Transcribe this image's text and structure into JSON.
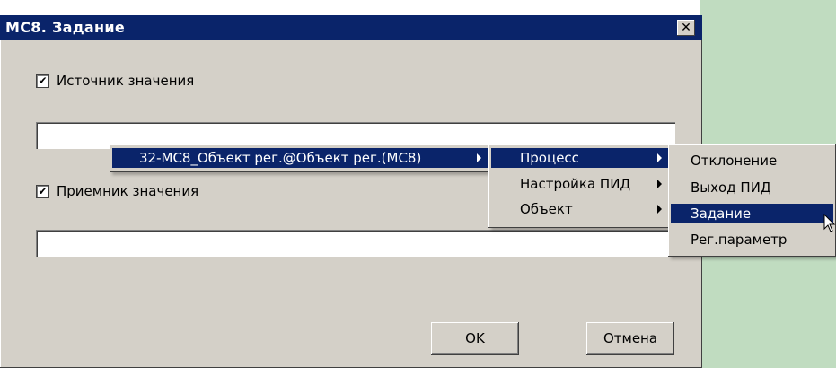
{
  "dialog": {
    "title": "МС8. Задание",
    "close_glyph": "✕",
    "source_checkbox_label": "Источник значения",
    "source_checked": true,
    "source_value": "",
    "receiver_checkbox_label": "Приемник значения",
    "receiver_checked": true,
    "receiver_value": "",
    "ok_label": "OK",
    "cancel_label": "Отмена"
  },
  "menus": {
    "level1": [
      "32-МС8_Объект рег.@Объект рег.(МС8)"
    ],
    "level2": [
      "Процесс",
      "Настройка ПИД",
      "Объект"
    ],
    "level3": [
      "Отклонение",
      "Выход ПИД",
      "Задание",
      "Рег.параметр"
    ]
  },
  "colors": {
    "title_bar": "#0a246a",
    "dialog_bg": "#d4d0c8",
    "side_panel": "#c0dcc0",
    "selection": "#0a246a"
  }
}
